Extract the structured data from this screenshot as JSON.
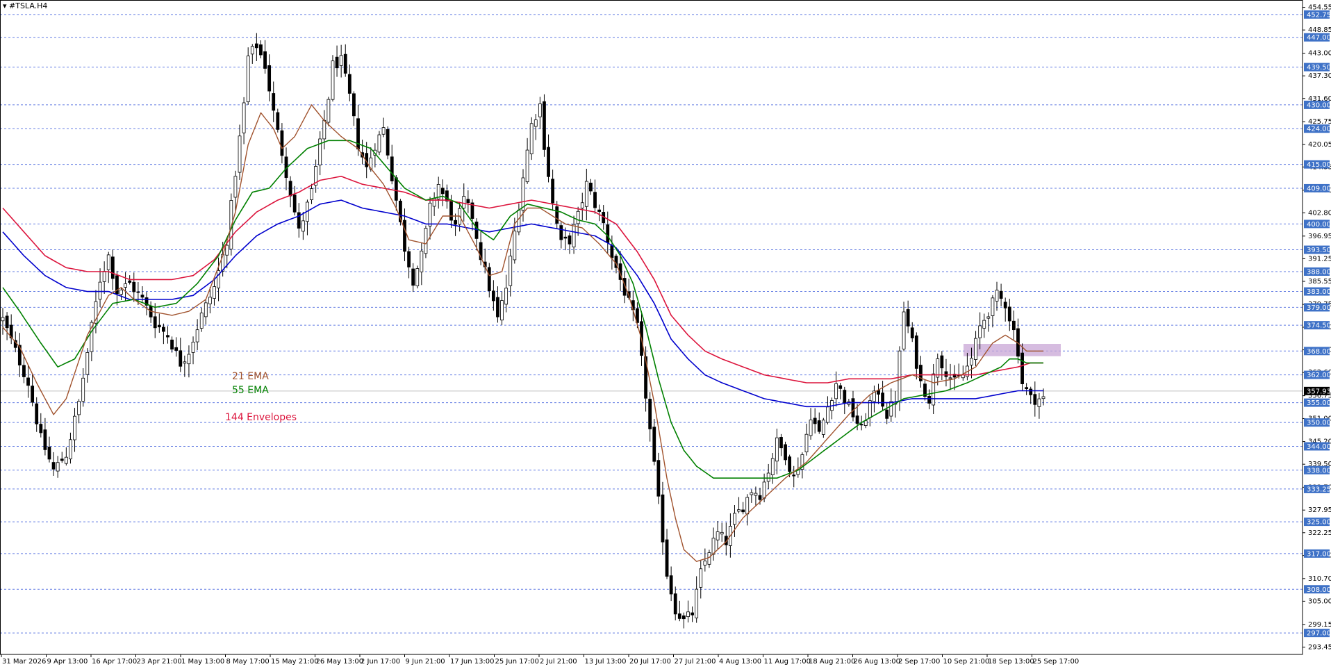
{
  "symbol_label": "▾ #TSLA.H4",
  "legend": {
    "ema21": "21 EMA",
    "ema55": "55 EMA",
    "env144": "144 Envelopes"
  },
  "colors": {
    "candle": "#000000",
    "ema21": "#a0522d",
    "ema55": "#008000",
    "env_upper": "#dc143c",
    "env_lower": "#0000cd",
    "level_line": "#3b5bdb",
    "level_box": "#3f72c7",
    "zone": "#c8a6d6",
    "price_line": "#c0c0c0",
    "price_box": "#000000"
  },
  "chart_data": {
    "type": "candlestick",
    "ylim": [
      291.6,
      456.4
    ],
    "y_ticks": [
      "454.55",
      "448.85",
      "443.00",
      "437.30",
      "431.60",
      "425.75",
      "420.05",
      "414.35",
      "408.50",
      "402.80",
      "396.95",
      "391.25",
      "385.55",
      "379.75",
      "374.00",
      "368.30",
      "362.60",
      "356.75",
      "351.00",
      "345.20",
      "339.50",
      "333.70",
      "327.95",
      "322.25",
      "316.50",
      "310.70",
      "305.00",
      "299.15",
      "293.45"
    ],
    "x_labels": [
      "31 Mar 2026",
      "9 Apr 13:00",
      "16 Apr 17:00",
      "23 Apr 21:00",
      "1 May 13:00",
      "8 May 17:00",
      "15 May 21:00",
      "26 May 13:00",
      "2 Jun 17:00",
      "9 Jun 21:00",
      "17 Jun 13:00",
      "25 Jun 17:00",
      "2 Jul 21:00",
      "13 Jul 13:00",
      "20 Jul 17:00",
      "27 Jul 21:00",
      "4 Aug 13:00",
      "11 Aug 17:00",
      "18 Aug 21:00",
      "26 Aug 13:00",
      "2 Sep 17:00",
      "10 Sep 21:00",
      "18 Sep 13:00",
      "25 Sep 17:00"
    ],
    "levels": [
      "452.75",
      "447.00",
      "439.50",
      "430.00",
      "424.00",
      "415.00",
      "409.00",
      "400.00",
      "393.50",
      "388.00",
      "383.00",
      "379.00",
      "374.50",
      "368.00",
      "362.00",
      "355.00",
      "350.00",
      "344.00",
      "338.00",
      "333.25",
      "325.00",
      "317.00",
      "308.00",
      "297.00"
    ],
    "current_price": "357.93",
    "zone": {
      "low": 366.7,
      "high": 369.8
    },
    "bars": 247,
    "close_path": [
      [
        0,
        376
      ],
      [
        3,
        368
      ],
      [
        6,
        360
      ],
      [
        9,
        346
      ],
      [
        12,
        338
      ],
      [
        15,
        342
      ],
      [
        18,
        355
      ],
      [
        21,
        374
      ],
      [
        23,
        386
      ],
      [
        25,
        392
      ],
      [
        27,
        383
      ],
      [
        30,
        385
      ],
      [
        33,
        381
      ],
      [
        36,
        375
      ],
      [
        39,
        372
      ],
      [
        42,
        365
      ],
      [
        44,
        368
      ],
      [
        47,
        377
      ],
      [
        50,
        384
      ],
      [
        53,
        396
      ],
      [
        55,
        413
      ],
      [
        57,
        430
      ],
      [
        58,
        442
      ],
      [
        60,
        445
      ],
      [
        62,
        440
      ],
      [
        64,
        428
      ],
      [
        66,
        418
      ],
      [
        68,
        408
      ],
      [
        70,
        398
      ],
      [
        73,
        408
      ],
      [
        75,
        420
      ],
      [
        77,
        432
      ],
      [
        78,
        440
      ],
      [
        80,
        441
      ],
      [
        82,
        432
      ],
      [
        84,
        420
      ],
      [
        86,
        414
      ],
      [
        88,
        420
      ],
      [
        90,
        424
      ],
      [
        91,
        418
      ],
      [
        93,
        406
      ],
      [
        95,
        394
      ],
      [
        97,
        386
      ],
      [
        99,
        392
      ],
      [
        101,
        404
      ],
      [
        103,
        410
      ],
      [
        105,
        405
      ],
      [
        107,
        399
      ],
      [
        109,
        406
      ],
      [
        111,
        402
      ],
      [
        113,
        392
      ],
      [
        115,
        384
      ],
      [
        117,
        376
      ],
      [
        119,
        384
      ],
      [
        121,
        398
      ],
      [
        123,
        412
      ],
      [
        125,
        425
      ],
      [
        127,
        430
      ],
      [
        128,
        420
      ],
      [
        130,
        405
      ],
      [
        132,
        395
      ],
      [
        134,
        396
      ],
      [
        136,
        402
      ],
      [
        138,
        410
      ],
      [
        140,
        405
      ],
      [
        142,
        400
      ],
      [
        144,
        392
      ],
      [
        146,
        386
      ],
      [
        148,
        380
      ],
      [
        150,
        374
      ],
      [
        152,
        357
      ],
      [
        153,
        348
      ],
      [
        155,
        330
      ],
      [
        157,
        312
      ],
      [
        159,
        303
      ],
      [
        161,
        300
      ],
      [
        163,
        302
      ],
      [
        165,
        312
      ],
      [
        167,
        318
      ],
      [
        169,
        322
      ],
      [
        171,
        320
      ],
      [
        173,
        326
      ],
      [
        175,
        329
      ],
      [
        177,
        333
      ],
      [
        179,
        332
      ],
      [
        181,
        338
      ],
      [
        183,
        345
      ],
      [
        185,
        342
      ],
      [
        187,
        336
      ],
      [
        189,
        342
      ],
      [
        191,
        352
      ],
      [
        193,
        347
      ],
      [
        195,
        354
      ],
      [
        197,
        360
      ],
      [
        199,
        356
      ],
      [
        201,
        352
      ],
      [
        203,
        348
      ],
      [
        205,
        355
      ],
      [
        207,
        358
      ],
      [
        209,
        352
      ],
      [
        211,
        356
      ],
      [
        213,
        378
      ],
      [
        215,
        370
      ],
      [
        217,
        360
      ],
      [
        219,
        356
      ],
      [
        221,
        367
      ],
      [
        223,
        363
      ],
      [
        225,
        360
      ],
      [
        227,
        362
      ],
      [
        229,
        366
      ],
      [
        231,
        374
      ],
      [
        233,
        378
      ],
      [
        235,
        382
      ],
      [
        237,
        380
      ],
      [
        239,
        373
      ],
      [
        240,
        368
      ],
      [
        241,
        360
      ],
      [
        243,
        356
      ]
    ],
    "ema21_path": [
      [
        0,
        374
      ],
      [
        4,
        369
      ],
      [
        8,
        360
      ],
      [
        12,
        352
      ],
      [
        15,
        356
      ],
      [
        20,
        372
      ],
      [
        25,
        382
      ],
      [
        28,
        384
      ],
      [
        31,
        381
      ],
      [
        35,
        378
      ],
      [
        40,
        377
      ],
      [
        44,
        378
      ],
      [
        48,
        381
      ],
      [
        52,
        392
      ],
      [
        55,
        403
      ],
      [
        58,
        420
      ],
      [
        61,
        428
      ],
      [
        64,
        424
      ],
      [
        66,
        419
      ],
      [
        69,
        422
      ],
      [
        73,
        430
      ],
      [
        76,
        426
      ],
      [
        80,
        422
      ],
      [
        84,
        419
      ],
      [
        87,
        414
      ],
      [
        90,
        410
      ],
      [
        93,
        404
      ],
      [
        96,
        396
      ],
      [
        100,
        395
      ],
      [
        104,
        402
      ],
      [
        108,
        402
      ],
      [
        112,
        394
      ],
      [
        115,
        387
      ],
      [
        118,
        388
      ],
      [
        121,
        400
      ],
      [
        124,
        404
      ],
      [
        127,
        404
      ],
      [
        130,
        402
      ],
      [
        133,
        400
      ],
      [
        137,
        399
      ],
      [
        141,
        395
      ],
      [
        145,
        390
      ],
      [
        148,
        382
      ],
      [
        151,
        371
      ],
      [
        154,
        355
      ],
      [
        157,
        336
      ],
      [
        159,
        326
      ],
      [
        161,
        318
      ],
      [
        164,
        315
      ],
      [
        167,
        316
      ],
      [
        171,
        320
      ],
      [
        175,
        326
      ],
      [
        180,
        331
      ],
      [
        185,
        336
      ],
      [
        190,
        340
      ],
      [
        195,
        346
      ],
      [
        200,
        352
      ],
      [
        205,
        357
      ],
      [
        210,
        360
      ],
      [
        215,
        362
      ],
      [
        220,
        360
      ],
      [
        225,
        361
      ],
      [
        230,
        364
      ],
      [
        234,
        370
      ],
      [
        237,
        372
      ],
      [
        240,
        370
      ],
      [
        242,
        368
      ]
    ],
    "ema55_path": [
      [
        0,
        384
      ],
      [
        4,
        378
      ],
      [
        9,
        370
      ],
      [
        13,
        364
      ],
      [
        17,
        366
      ],
      [
        21,
        373
      ],
      [
        26,
        380
      ],
      [
        31,
        381
      ],
      [
        36,
        379
      ],
      [
        41,
        380
      ],
      [
        46,
        385
      ],
      [
        51,
        392
      ],
      [
        55,
        401
      ],
      [
        59,
        408
      ],
      [
        63,
        409
      ],
      [
        67,
        414
      ],
      [
        72,
        419
      ],
      [
        77,
        421
      ],
      [
        82,
        421
      ],
      [
        87,
        419
      ],
      [
        91,
        414
      ],
      [
        95,
        409
      ],
      [
        100,
        406
      ],
      [
        104,
        407
      ],
      [
        108,
        405
      ],
      [
        112,
        399
      ],
      [
        116,
        396
      ],
      [
        120,
        402
      ],
      [
        124,
        405
      ],
      [
        128,
        404
      ],
      [
        132,
        403
      ],
      [
        136,
        401
      ],
      [
        140,
        400
      ],
      [
        143,
        397
      ],
      [
        146,
        392
      ],
      [
        149,
        385
      ],
      [
        152,
        374
      ],
      [
        155,
        361
      ],
      [
        158,
        350
      ],
      [
        161,
        343
      ],
      [
        164,
        339
      ],
      [
        168,
        336
      ],
      [
        173,
        336
      ],
      [
        178,
        336
      ],
      [
        183,
        336
      ],
      [
        188,
        338
      ],
      [
        193,
        342
      ],
      [
        198,
        346
      ],
      [
        203,
        350
      ],
      [
        208,
        353
      ],
      [
        213,
        356
      ],
      [
        218,
        357
      ],
      [
        223,
        358
      ],
      [
        228,
        360
      ],
      [
        232,
        362
      ],
      [
        236,
        364
      ],
      [
        238,
        366
      ],
      [
        240,
        366
      ],
      [
        242,
        365
      ]
    ],
    "env_upper_path": [
      [
        0,
        404
      ],
      [
        5,
        398
      ],
      [
        10,
        392
      ],
      [
        15,
        389
      ],
      [
        20,
        388
      ],
      [
        25,
        388
      ],
      [
        30,
        386
      ],
      [
        35,
        386
      ],
      [
        40,
        386
      ],
      [
        45,
        387
      ],
      [
        50,
        391
      ],
      [
        55,
        398
      ],
      [
        60,
        403
      ],
      [
        65,
        406
      ],
      [
        70,
        408
      ],
      [
        75,
        411
      ],
      [
        80,
        412
      ],
      [
        85,
        410
      ],
      [
        90,
        409
      ],
      [
        95,
        408
      ],
      [
        100,
        406
      ],
      [
        105,
        406
      ],
      [
        110,
        405
      ],
      [
        115,
        404
      ],
      [
        120,
        405
      ],
      [
        125,
        406
      ],
      [
        130,
        405
      ],
      [
        135,
        404
      ],
      [
        140,
        403
      ],
      [
        145,
        400
      ],
      [
        150,
        393
      ],
      [
        154,
        386
      ],
      [
        158,
        377
      ],
      [
        162,
        372
      ],
      [
        166,
        368
      ],
      [
        170,
        366
      ],
      [
        175,
        364
      ],
      [
        180,
        362
      ],
      [
        185,
        361
      ],
      [
        190,
        360
      ],
      [
        195,
        360
      ],
      [
        200,
        361
      ],
      [
        205,
        361
      ],
      [
        210,
        361
      ],
      [
        215,
        362
      ],
      [
        220,
        362
      ],
      [
        225,
        362
      ],
      [
        230,
        362
      ],
      [
        235,
        363
      ],
      [
        240,
        364
      ],
      [
        243,
        365
      ]
    ],
    "env_lower_path": [
      [
        0,
        398
      ],
      [
        5,
        392
      ],
      [
        10,
        387
      ],
      [
        15,
        384
      ],
      [
        20,
        383
      ],
      [
        25,
        383
      ],
      [
        30,
        381
      ],
      [
        35,
        381
      ],
      [
        40,
        381
      ],
      [
        45,
        382
      ],
      [
        50,
        386
      ],
      [
        55,
        392
      ],
      [
        60,
        397
      ],
      [
        65,
        400
      ],
      [
        70,
        402
      ],
      [
        75,
        405
      ],
      [
        80,
        406
      ],
      [
        85,
        404
      ],
      [
        90,
        403
      ],
      [
        95,
        402
      ],
      [
        100,
        400
      ],
      [
        105,
        400
      ],
      [
        110,
        399
      ],
      [
        115,
        398
      ],
      [
        120,
        399
      ],
      [
        125,
        400
      ],
      [
        130,
        399
      ],
      [
        135,
        398
      ],
      [
        140,
        397
      ],
      [
        145,
        394
      ],
      [
        150,
        387
      ],
      [
        154,
        380
      ],
      [
        158,
        371
      ],
      [
        162,
        366
      ],
      [
        166,
        362
      ],
      [
        170,
        360
      ],
      [
        175,
        358
      ],
      [
        180,
        356
      ],
      [
        185,
        355
      ],
      [
        190,
        354
      ],
      [
        195,
        354
      ],
      [
        200,
        355
      ],
      [
        205,
        355
      ],
      [
        210,
        355
      ],
      [
        215,
        356
      ],
      [
        220,
        356
      ],
      [
        225,
        356
      ],
      [
        230,
        356
      ],
      [
        235,
        357
      ],
      [
        240,
        358
      ],
      [
        243,
        358
      ]
    ]
  }
}
